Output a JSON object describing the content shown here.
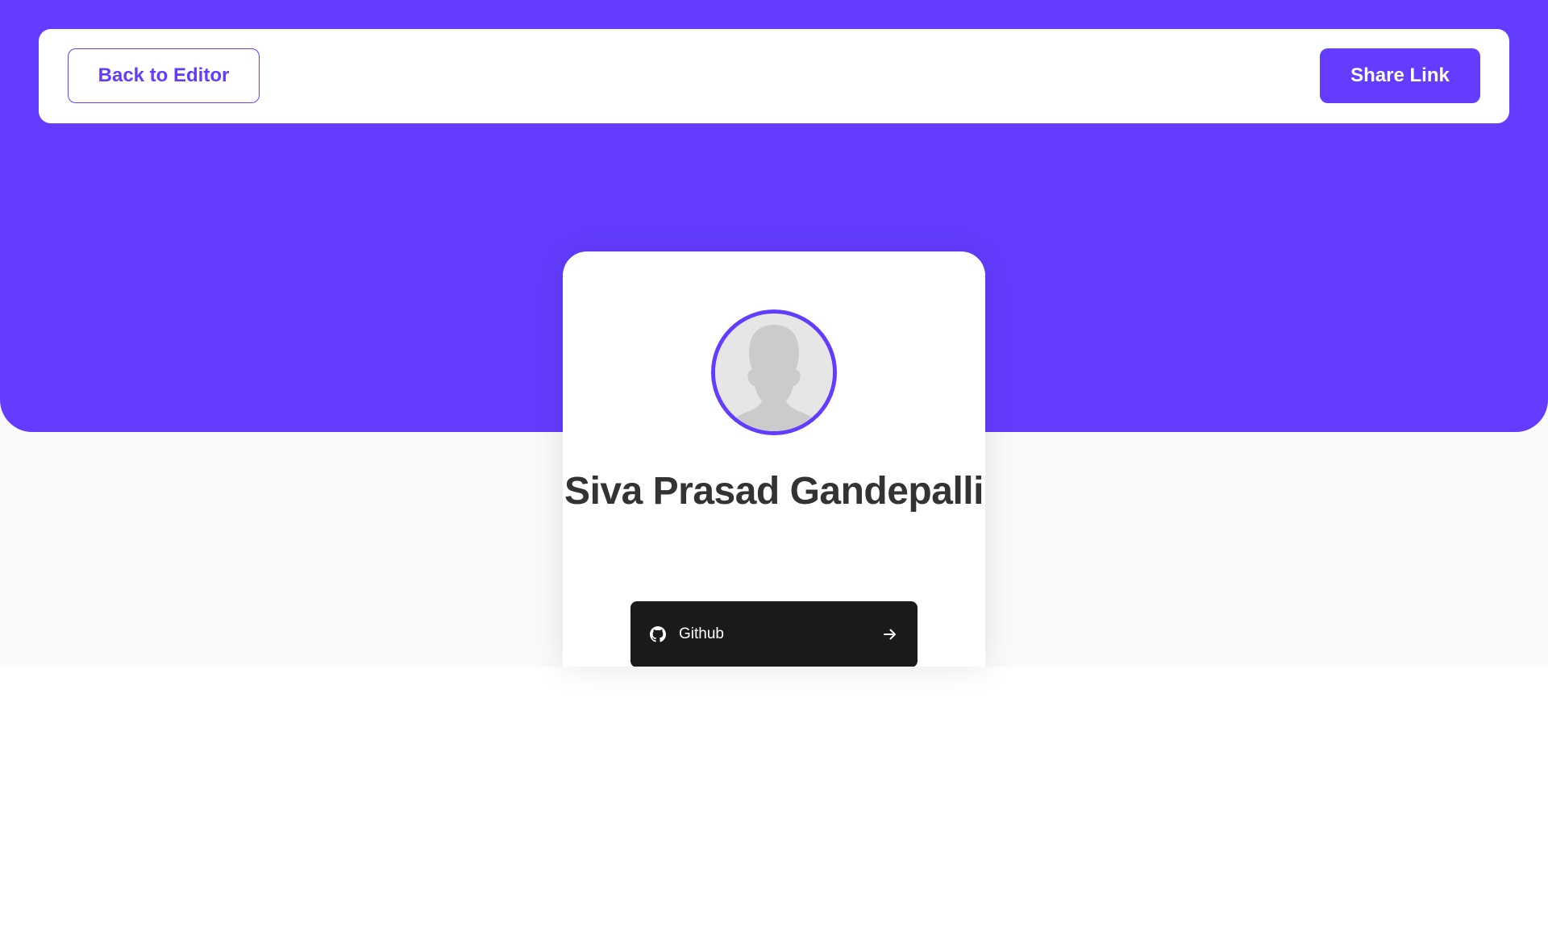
{
  "colors": {
    "accent": "#633cff",
    "background": "#fafafa",
    "card": "#ffffff",
    "name_text": "#333333",
    "link_github_bg": "#1a1a1a"
  },
  "navbar": {
    "back_label": "Back to Editor",
    "share_label": "Share Link"
  },
  "profile": {
    "name": "Siva Prasad Gandepalli",
    "avatar_icon": "default-person-silhouette"
  },
  "links": [
    {
      "platform": "Github",
      "icon": "github-icon",
      "action_icon": "arrow-right-icon"
    }
  ]
}
